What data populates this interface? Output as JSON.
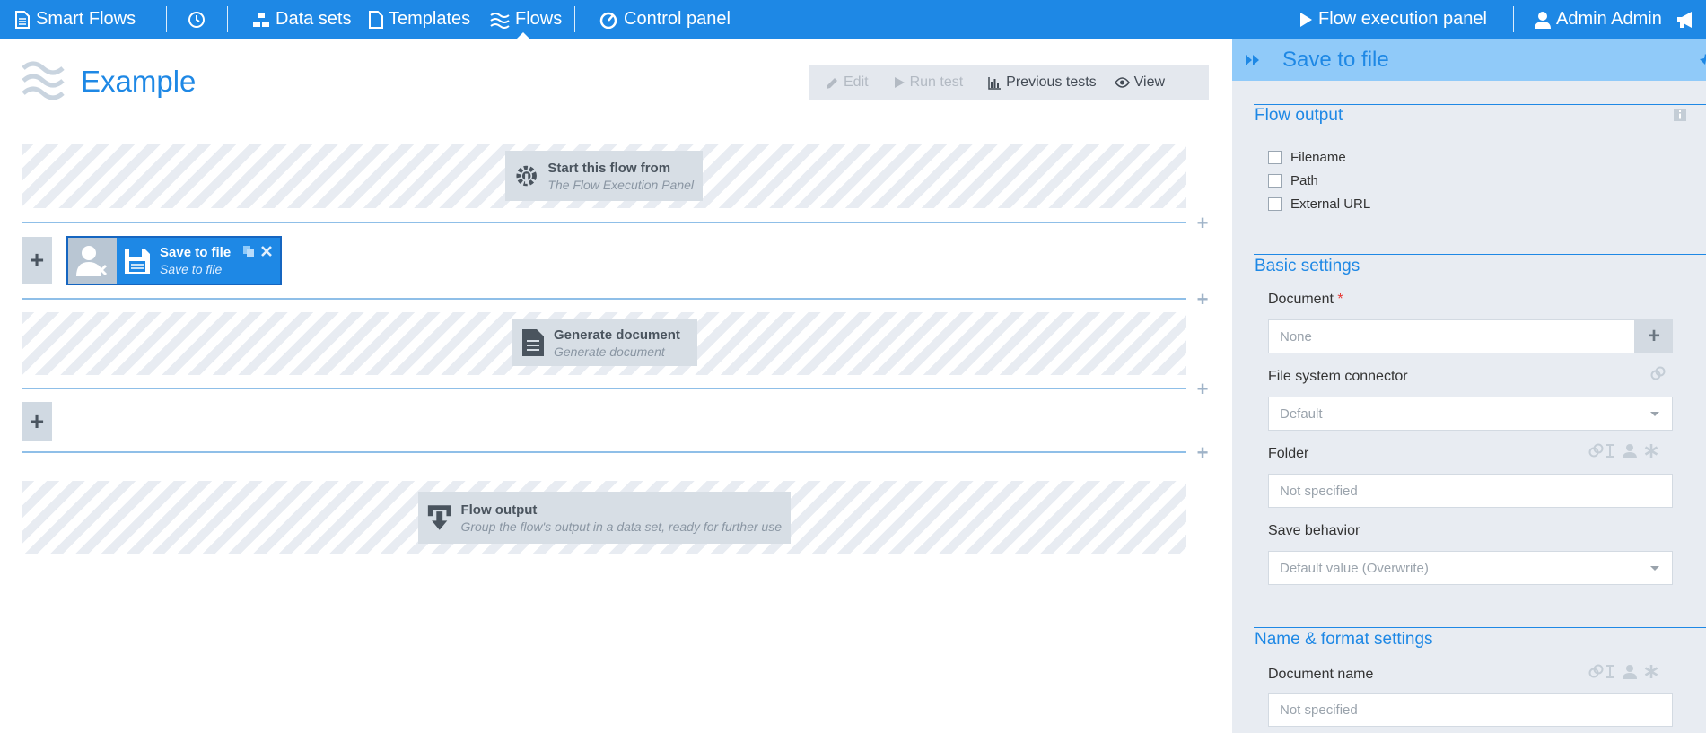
{
  "nav": {
    "brand": "Smart Flows",
    "items": [
      "Data sets",
      "Templates",
      "Flows",
      "Control panel"
    ],
    "flow_execution_panel": "Flow execution panel",
    "user": "Admin Admin"
  },
  "page": {
    "title": "Example",
    "toolbar": {
      "edit": "Edit",
      "run_test": "Run test",
      "previous_tests": "Previous tests",
      "view": "View"
    }
  },
  "canvas": {
    "start": {
      "title": "Start this flow from",
      "subtitle": "The Flow Execution Panel"
    },
    "save": {
      "title": "Save to file",
      "subtitle": "Save to file"
    },
    "generate": {
      "title": "Generate document",
      "subtitle": "Generate document"
    },
    "output": {
      "title": "Flow output",
      "subtitle": "Group the flow's output in a data set, ready for further use"
    },
    "add_symbol": "+"
  },
  "panel": {
    "title": "Save to file",
    "flow_output": {
      "heading": "Flow output",
      "options": [
        "Filename",
        "Path",
        "External URL"
      ]
    },
    "basic": {
      "heading": "Basic settings",
      "document_label": "Document",
      "required_mark": "*",
      "document_value": "None",
      "fs_label": "File system connector",
      "fs_value": "Default",
      "folder_label": "Folder",
      "folder_value": "Not specified",
      "save_label": "Save behavior",
      "save_value": "Default value (Overwrite)"
    },
    "name_format": {
      "heading": "Name & format settings",
      "docname_label": "Document name",
      "docname_value": "Not specified"
    }
  },
  "colors": {
    "accent": "#1e88e5",
    "panel_header": "#90caf9",
    "panel_bg": "#e8ecf2"
  }
}
